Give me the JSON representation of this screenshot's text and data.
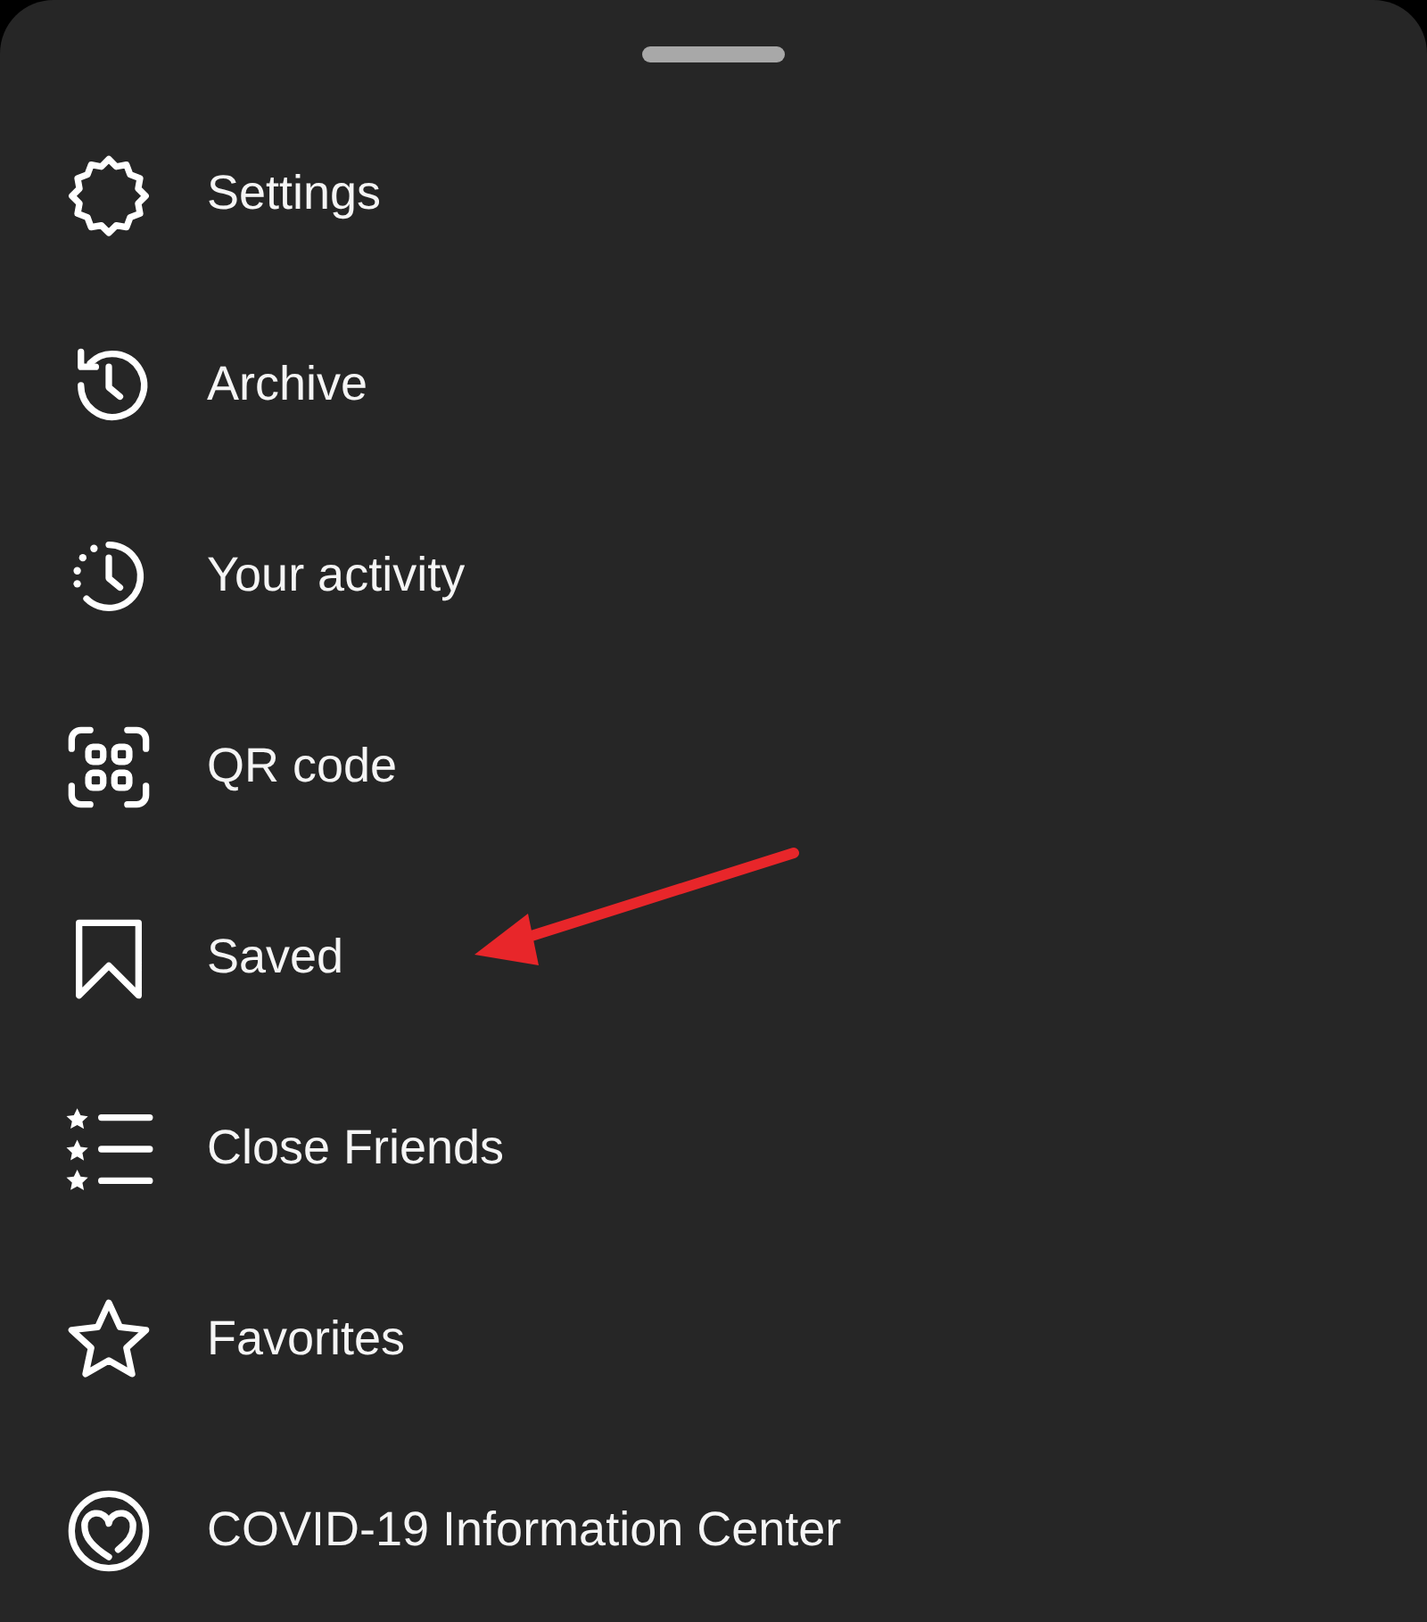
{
  "menu": {
    "items": [
      {
        "label": "Settings"
      },
      {
        "label": "Archive"
      },
      {
        "label": "Your activity"
      },
      {
        "label": "QR code"
      },
      {
        "label": "Saved"
      },
      {
        "label": "Close Friends"
      },
      {
        "label": "Favorites"
      },
      {
        "label": "COVID-19 Information Center"
      }
    ]
  },
  "annotations": [
    {
      "kind": "arrow",
      "color": "#e8262a"
    }
  ]
}
